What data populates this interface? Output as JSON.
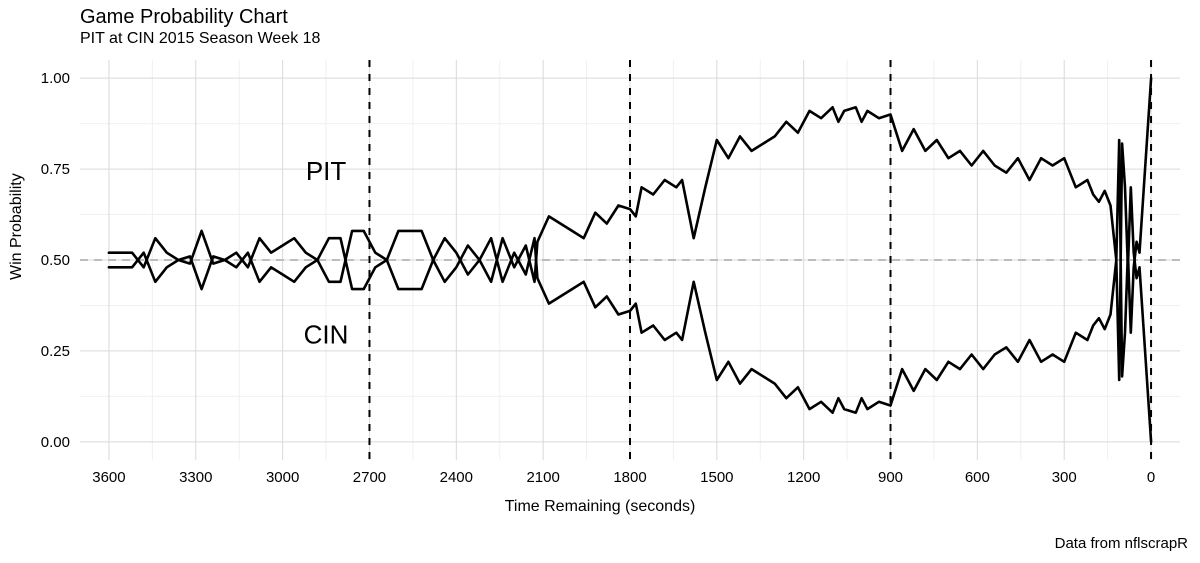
{
  "title": "Game Probability Chart",
  "subtitle": "PIT at CIN 2015 Season Week 18",
  "xlabel": "Time Remaining (seconds)",
  "ylabel": "Win Probability",
  "caption": "Data from nflscrapR",
  "annotations": {
    "pit": "PIT",
    "cin": "CIN"
  },
  "chart_data": {
    "type": "line",
    "xlim": [
      3700,
      -100
    ],
    "ylim": [
      -0.05,
      1.05
    ],
    "x_ticks": [
      3600,
      3300,
      3000,
      2700,
      2400,
      2100,
      1800,
      1500,
      1200,
      900,
      600,
      300,
      0
    ],
    "y_ticks": [
      0.0,
      0.25,
      0.5,
      0.75,
      1.0
    ],
    "vlines": [
      2700,
      1800,
      900,
      0
    ],
    "hline": 0.5,
    "annotation_positions": {
      "pit": {
        "x": 2850,
        "y": 0.72
      },
      "cin": {
        "x": 2850,
        "y": 0.27
      }
    },
    "series": [
      {
        "name": "PIT",
        "x": [
          3600,
          3560,
          3520,
          3480,
          3440,
          3400,
          3360,
          3320,
          3280,
          3240,
          3200,
          3160,
          3120,
          3080,
          3040,
          3000,
          2960,
          2920,
          2880,
          2840,
          2800,
          2760,
          2720,
          2680,
          2640,
          2600,
          2560,
          2520,
          2480,
          2440,
          2400,
          2360,
          2320,
          2280,
          2240,
          2200,
          2160,
          2130,
          2120,
          2080,
          2040,
          2000,
          1960,
          1920,
          1880,
          1840,
          1800,
          1780,
          1760,
          1720,
          1680,
          1640,
          1620,
          1580,
          1540,
          1500,
          1460,
          1420,
          1380,
          1340,
          1300,
          1260,
          1220,
          1180,
          1140,
          1100,
          1080,
          1060,
          1020,
          1000,
          980,
          940,
          900,
          880,
          860,
          820,
          780,
          740,
          700,
          660,
          620,
          580,
          540,
          500,
          460,
          420,
          380,
          340,
          300,
          260,
          220,
          200,
          180,
          160,
          140,
          120,
          110,
          100,
          90,
          80,
          70,
          60,
          50,
          40,
          0
        ],
        "values": [
          0.52,
          0.52,
          0.52,
          0.48,
          0.56,
          0.52,
          0.5,
          0.49,
          0.58,
          0.49,
          0.5,
          0.52,
          0.48,
          0.56,
          0.52,
          0.54,
          0.56,
          0.52,
          0.5,
          0.44,
          0.44,
          0.58,
          0.58,
          0.52,
          0.5,
          0.42,
          0.42,
          0.42,
          0.5,
          0.56,
          0.52,
          0.46,
          0.5,
          0.44,
          0.56,
          0.48,
          0.54,
          0.44,
          0.55,
          0.62,
          0.6,
          0.58,
          0.56,
          0.63,
          0.6,
          0.65,
          0.64,
          0.62,
          0.7,
          0.68,
          0.72,
          0.7,
          0.72,
          0.56,
          0.7,
          0.83,
          0.78,
          0.84,
          0.8,
          0.82,
          0.84,
          0.88,
          0.85,
          0.91,
          0.89,
          0.92,
          0.88,
          0.91,
          0.92,
          0.88,
          0.91,
          0.89,
          0.9,
          0.85,
          0.8,
          0.86,
          0.8,
          0.83,
          0.78,
          0.8,
          0.76,
          0.8,
          0.76,
          0.74,
          0.78,
          0.72,
          0.78,
          0.76,
          0.78,
          0.7,
          0.72,
          0.68,
          0.66,
          0.69,
          0.65,
          0.5,
          0.83,
          0.18,
          0.3,
          0.52,
          0.3,
          0.48,
          0.55,
          0.52,
          1.0
        ]
      },
      {
        "name": "CIN",
        "x": [
          3600,
          3560,
          3520,
          3480,
          3440,
          3400,
          3360,
          3320,
          3280,
          3240,
          3200,
          3160,
          3120,
          3080,
          3040,
          3000,
          2960,
          2920,
          2880,
          2840,
          2800,
          2760,
          2720,
          2680,
          2640,
          2600,
          2560,
          2520,
          2480,
          2440,
          2400,
          2360,
          2320,
          2280,
          2240,
          2200,
          2160,
          2130,
          2120,
          2080,
          2040,
          2000,
          1960,
          1920,
          1880,
          1840,
          1800,
          1780,
          1760,
          1720,
          1680,
          1640,
          1620,
          1580,
          1540,
          1500,
          1460,
          1420,
          1380,
          1340,
          1300,
          1260,
          1220,
          1180,
          1140,
          1100,
          1080,
          1060,
          1020,
          1000,
          980,
          940,
          900,
          880,
          860,
          820,
          780,
          740,
          700,
          660,
          620,
          580,
          540,
          500,
          460,
          420,
          380,
          340,
          300,
          260,
          220,
          200,
          180,
          160,
          140,
          120,
          110,
          100,
          90,
          80,
          70,
          60,
          50,
          40,
          0
        ],
        "values": [
          0.48,
          0.48,
          0.48,
          0.52,
          0.44,
          0.48,
          0.5,
          0.51,
          0.42,
          0.51,
          0.5,
          0.48,
          0.52,
          0.44,
          0.48,
          0.46,
          0.44,
          0.48,
          0.5,
          0.56,
          0.56,
          0.42,
          0.42,
          0.48,
          0.5,
          0.58,
          0.58,
          0.58,
          0.5,
          0.44,
          0.48,
          0.54,
          0.5,
          0.56,
          0.44,
          0.52,
          0.46,
          0.56,
          0.45,
          0.38,
          0.4,
          0.42,
          0.44,
          0.37,
          0.4,
          0.35,
          0.36,
          0.38,
          0.3,
          0.32,
          0.28,
          0.3,
          0.28,
          0.44,
          0.3,
          0.17,
          0.22,
          0.16,
          0.2,
          0.18,
          0.16,
          0.12,
          0.15,
          0.09,
          0.11,
          0.08,
          0.12,
          0.09,
          0.08,
          0.12,
          0.09,
          0.11,
          0.1,
          0.15,
          0.2,
          0.14,
          0.2,
          0.17,
          0.22,
          0.2,
          0.24,
          0.2,
          0.24,
          0.26,
          0.22,
          0.28,
          0.22,
          0.24,
          0.22,
          0.3,
          0.28,
          0.32,
          0.34,
          0.31,
          0.35,
          0.5,
          0.17,
          0.82,
          0.7,
          0.48,
          0.7,
          0.52,
          0.45,
          0.48,
          0.0
        ]
      }
    ]
  }
}
